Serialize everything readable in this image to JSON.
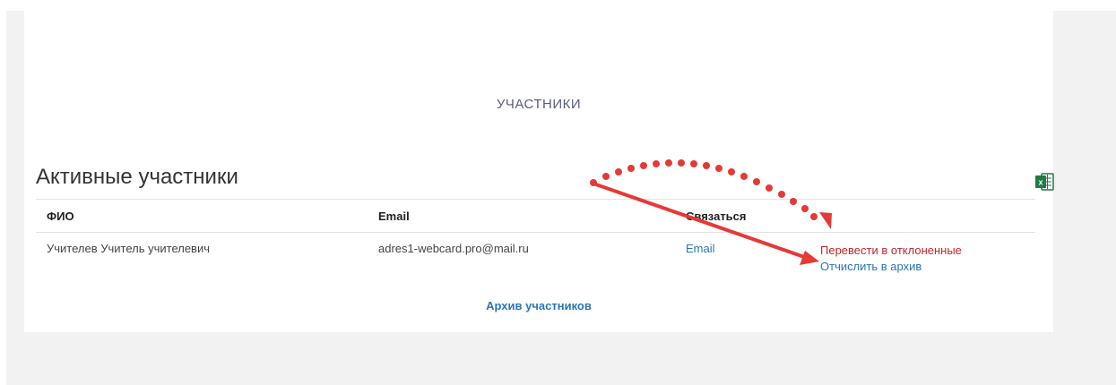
{
  "page": {
    "section_title": "УЧАСТНИКИ",
    "block_heading": "Активные участники",
    "archive_link": "Архив участников"
  },
  "table": {
    "headers": [
      "ФИО",
      "Email",
      "Связаться"
    ],
    "rows": [
      {
        "name": "Учителев Учитель учителевич",
        "email": "adres1-webcard.pro@mail.ru",
        "contact": "Email",
        "action_reject": "Перевести в отклоненные",
        "action_archive": "Отчислить в архив"
      }
    ]
  },
  "icons": {
    "export": "excel-icon"
  },
  "colors": {
    "link": "#2a75b5",
    "danger": "#c0272d",
    "annotation": "#e53935",
    "excel": "#1f7a45"
  }
}
